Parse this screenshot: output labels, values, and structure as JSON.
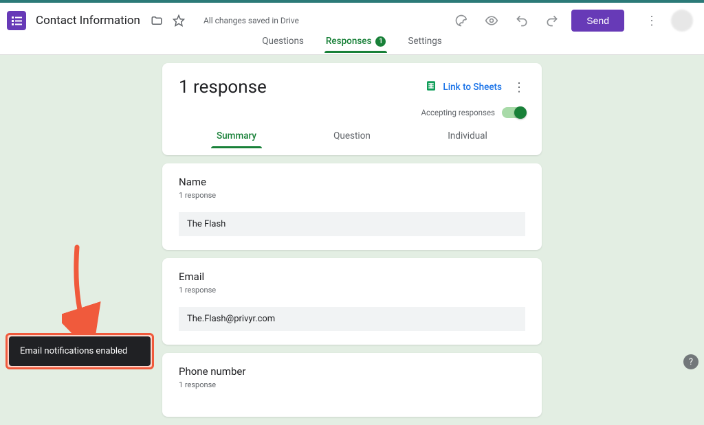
{
  "header": {
    "title": "Contact Information",
    "save_status": "All changes saved in Drive",
    "send_label": "Send"
  },
  "tabs": {
    "questions": "Questions",
    "responses": "Responses",
    "responses_count": "1",
    "settings": "Settings"
  },
  "responses_card": {
    "title": "1 response",
    "link_to_sheets": "Link to Sheets",
    "accepting_label": "Accepting responses",
    "subtabs": {
      "summary": "Summary",
      "question": "Question",
      "individual": "Individual"
    }
  },
  "questions": [
    {
      "title": "Name",
      "count": "1 response",
      "answer": "The Flash"
    },
    {
      "title": "Email",
      "count": "1 response",
      "answer": "The.Flash@privyr.com"
    },
    {
      "title": "Phone number",
      "count": "1 response",
      "answer": ""
    }
  ],
  "toast": {
    "message": "Email notifications enabled"
  },
  "icons": {
    "sheets_color": "#0f9d58",
    "help": "?"
  }
}
